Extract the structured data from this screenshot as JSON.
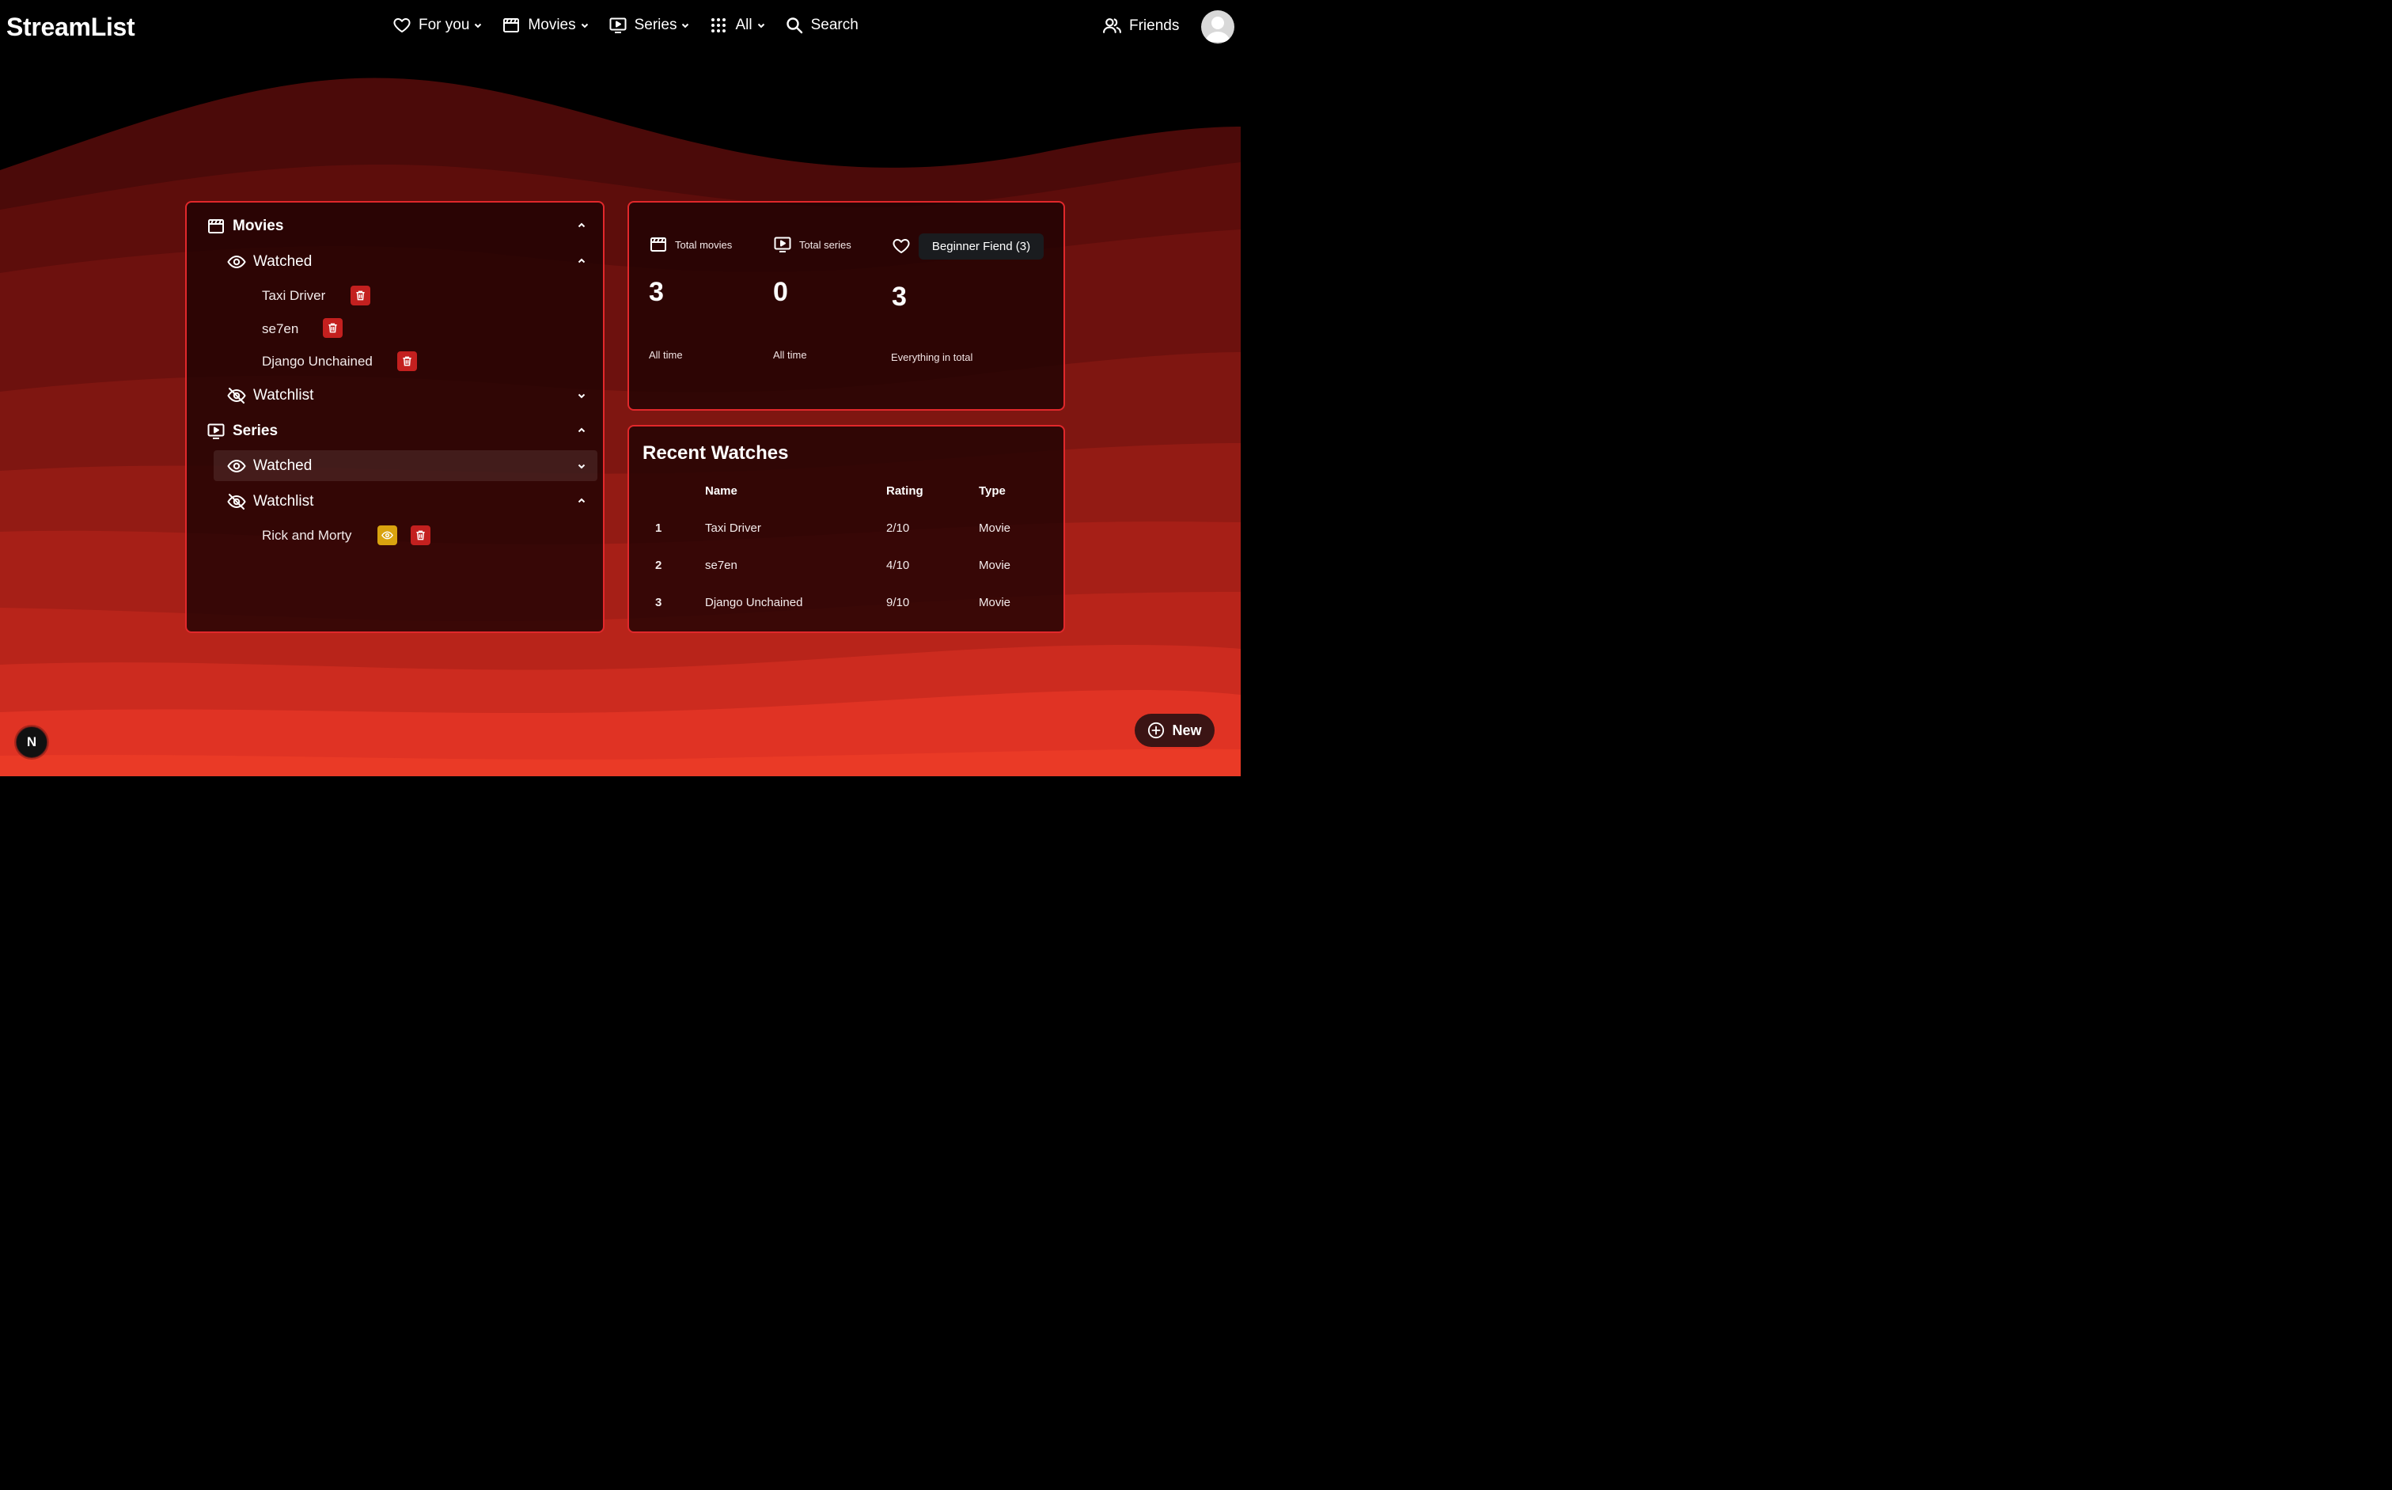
{
  "app": {
    "brand": "StreamList"
  },
  "nav": {
    "for_you": "For you",
    "movies": "Movies",
    "series": "Series",
    "all": "All",
    "search": "Search",
    "friends": "Friends"
  },
  "library": {
    "movies": {
      "title": "Movies",
      "watched_label": "Watched",
      "watched_items": [
        "Taxi Driver",
        "se7en",
        "Django Unchained"
      ],
      "watchlist_label": "Watchlist"
    },
    "series": {
      "title": "Series",
      "watched_label": "Watched",
      "watchlist_label": "Watchlist",
      "watchlist_items": [
        "Rick and Morty"
      ]
    }
  },
  "stats": {
    "total_movies_label": "Total movies",
    "total_movies_value": "3",
    "total_movies_sub": "All time",
    "total_series_label": "Total series",
    "total_series_value": "0",
    "total_series_sub": "All time",
    "badge": "Beginner Fiend (3)",
    "total_value": "3",
    "total_sub": "Everything in total"
  },
  "recent": {
    "title": "Recent Watches",
    "headers": {
      "name": "Name",
      "rating": "Rating",
      "type": "Type"
    },
    "rows": [
      {
        "num": "1",
        "name": "Taxi Driver",
        "rating": "2/10",
        "type": "Movie"
      },
      {
        "num": "2",
        "name": "se7en",
        "rating": "4/10",
        "type": "Movie"
      },
      {
        "num": "3",
        "name": "Django Unchained",
        "rating": "9/10",
        "type": "Movie"
      }
    ]
  },
  "fab": {
    "n_letter": "N",
    "new_label": "New"
  },
  "colors": {
    "accent": "#e1282b",
    "delete": "#c3201f",
    "watch": "#d9a30f"
  }
}
